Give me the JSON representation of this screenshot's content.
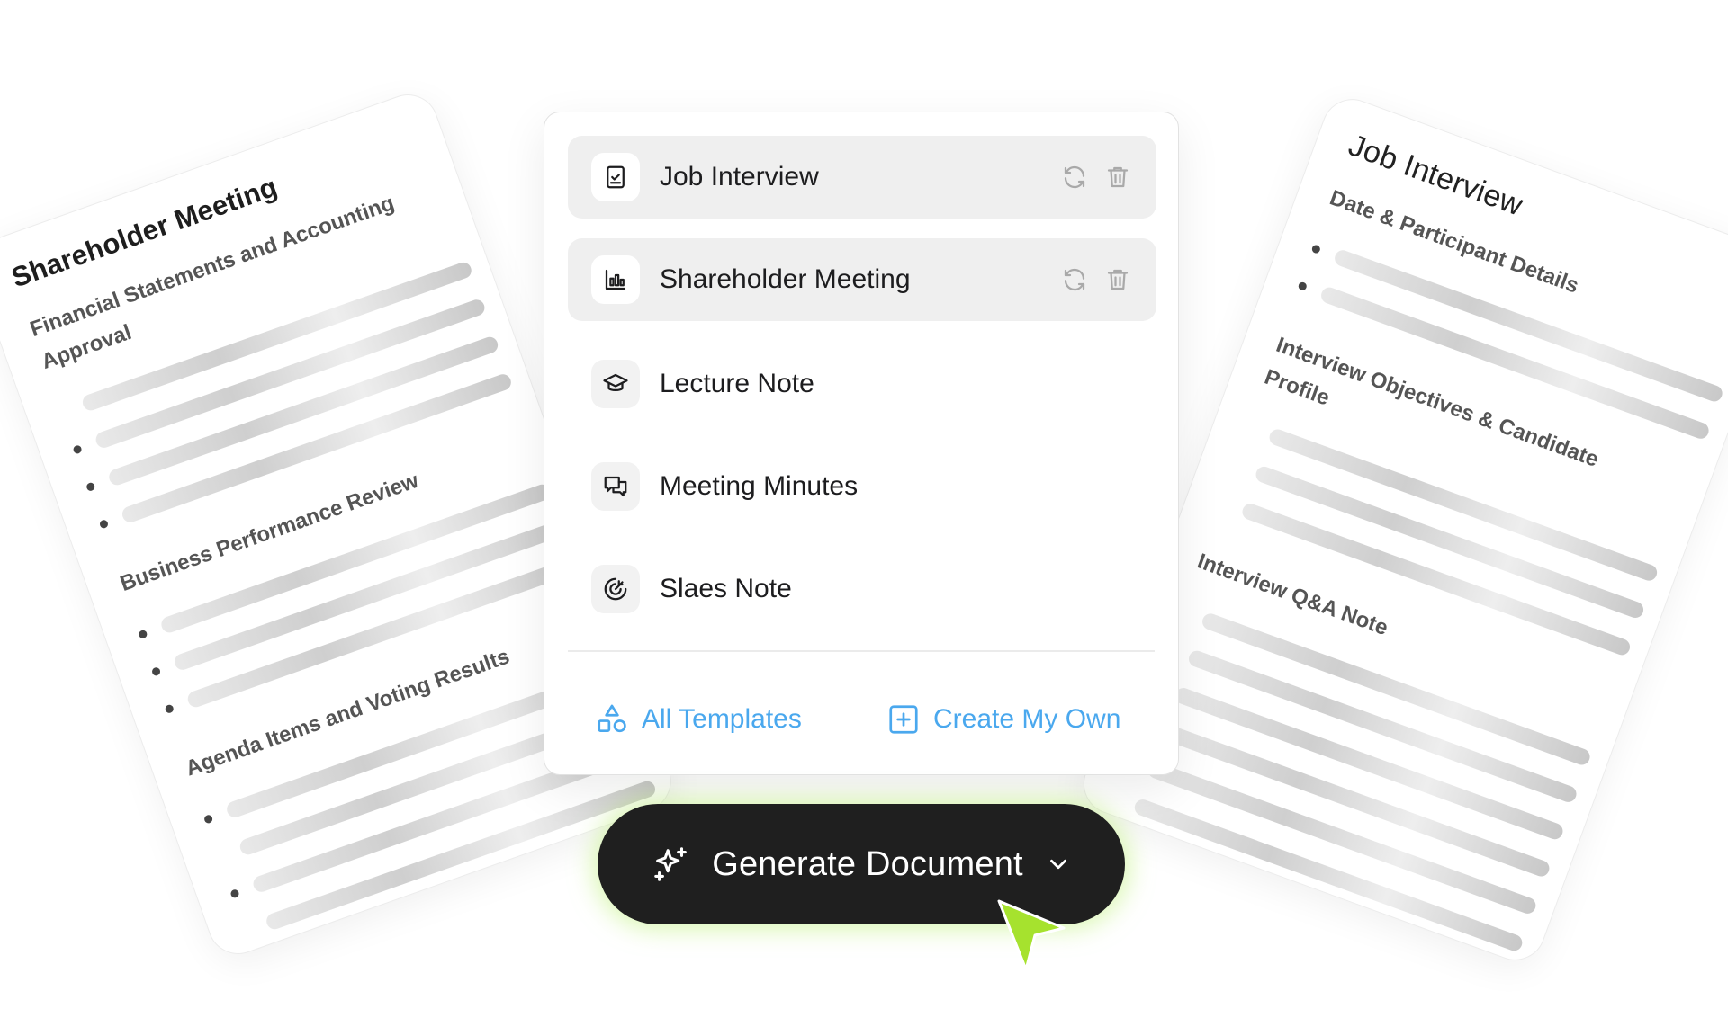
{
  "left_card": {
    "title": "Shareholder Meeting",
    "sections": [
      {
        "heading": "Financial Statements and Accounting Approval",
        "bullets": 3
      },
      {
        "heading": "Business Performance Review",
        "bullets": 3
      },
      {
        "heading": "Agenda Items and Voting Results",
        "bullets": 2
      }
    ]
  },
  "right_card": {
    "title": "Job Interview",
    "sections": [
      {
        "heading": "Date & Participant Details",
        "bullets": 2
      },
      {
        "heading": "Interview Objectives & Candidate Profile",
        "bullets": 0
      },
      {
        "heading": "Interview Q&A Note",
        "bullets": 0
      }
    ]
  },
  "templates": {
    "items": [
      {
        "label": "Job Interview",
        "icon": "clipboard-check-icon"
      },
      {
        "label": "Shareholder Meeting",
        "icon": "bar-chart-icon"
      },
      {
        "label": "Lecture Note",
        "icon": "graduation-cap-icon"
      },
      {
        "label": "Meeting Minutes",
        "icon": "chat-bubbles-icon"
      },
      {
        "label": "Slaes Note",
        "icon": "target-icon"
      }
    ],
    "all_templates_label": "All Templates",
    "create_own_label": "Create My Own"
  },
  "generate_button": {
    "label": "Generate Document"
  },
  "colors": {
    "accent": "#4aa8ee",
    "button_bg": "#1f1f1f",
    "glow": "#bef078",
    "cursor": "#a6e22e"
  }
}
